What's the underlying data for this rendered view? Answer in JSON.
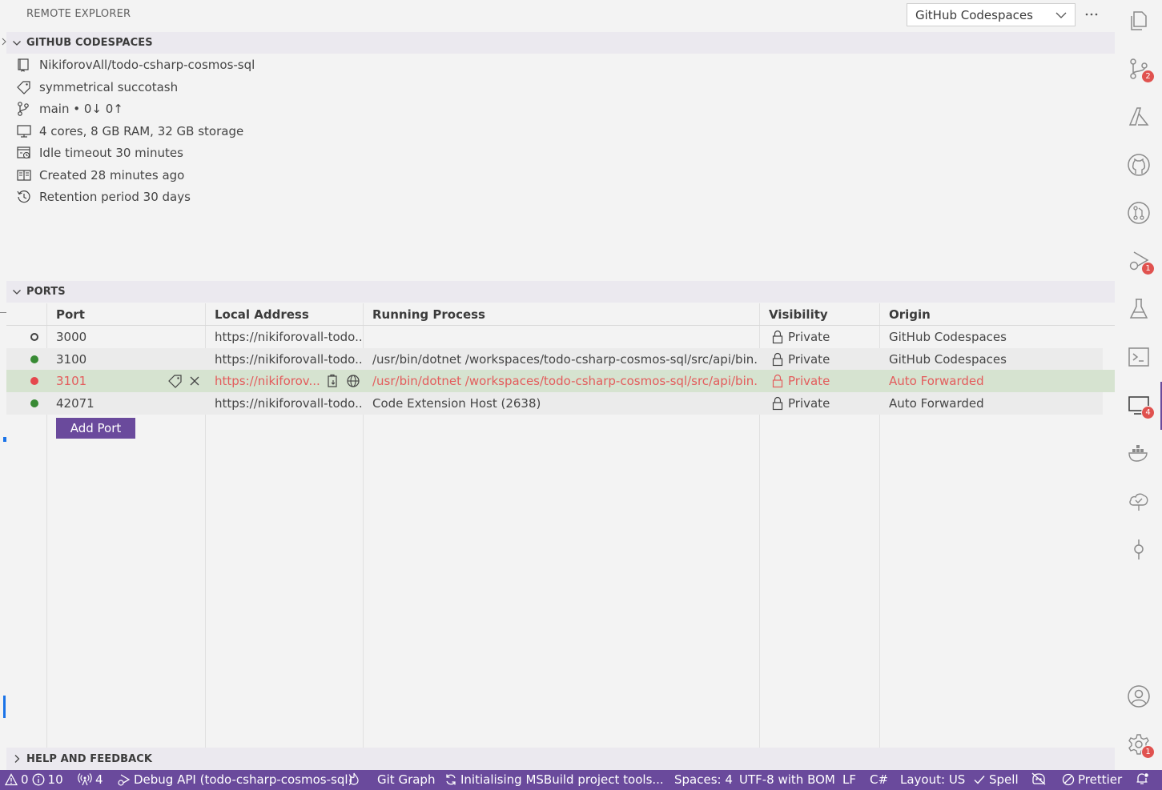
{
  "panel": {
    "title": "REMOTE EXPLORER",
    "view_select": "GitHub Codespaces"
  },
  "codespaces": {
    "header": "GITHUB CODESPACES",
    "items": [
      {
        "icon": "repo-icon",
        "label": "NikiforovAll/todo-csharp-cosmos-sql"
      },
      {
        "icon": "tag-icon",
        "label": "symmetrical succotash"
      },
      {
        "icon": "git-branch-icon",
        "label": "main • 0↓ 0↑"
      },
      {
        "icon": "vm-icon",
        "label": "4 cores, 8 GB RAM, 32 GB storage"
      },
      {
        "icon": "timeout-icon",
        "label": "Idle timeout 30 minutes"
      },
      {
        "icon": "book-icon",
        "label": "Created 28 minutes ago"
      },
      {
        "icon": "history-icon",
        "label": "Retention period 30 days"
      }
    ]
  },
  "ports": {
    "header": "PORTS",
    "columns": {
      "port": "Port",
      "local": "Local Address",
      "process": "Running Process",
      "visibility": "Visibility",
      "origin": "Origin"
    },
    "rows": [
      {
        "status": "inactive",
        "port": "3000",
        "local": "https://nikiforovall-todo...",
        "process": "",
        "visibility": "Private",
        "origin": "GitHub Codespaces"
      },
      {
        "status": "running",
        "port": "3100",
        "local": "https://nikiforovall-todo...",
        "process": "/usr/bin/dotnet /workspaces/todo-csharp-cosmos-sql/src/api/bin...",
        "visibility": "Private",
        "origin": "GitHub Codespaces"
      },
      {
        "status": "error",
        "port": "3101",
        "local": "https://nikiforov...",
        "process": "/usr/bin/dotnet /workspaces/todo-csharp-cosmos-sql/src/api/bin...",
        "visibility": "Private",
        "origin": "Auto Forwarded"
      },
      {
        "status": "running",
        "port": "42071",
        "local": "https://nikiforovall-todo...",
        "process": "Code Extension Host (2638)",
        "visibility": "Private",
        "origin": "Auto Forwarded"
      }
    ],
    "add_port": "Add Port"
  },
  "help": {
    "header": "HELP AND FEEDBACK"
  },
  "activity_bar": {
    "items": [
      {
        "name": "explorer-icon"
      },
      {
        "name": "source-control-icon",
        "badge": "2"
      },
      {
        "name": "azure-icon"
      },
      {
        "name": "github-icon"
      },
      {
        "name": "pull-requests-icon"
      },
      {
        "name": "run-debug-icon",
        "badge": "1"
      },
      {
        "name": "testing-icon"
      },
      {
        "name": "terminal-icon"
      },
      {
        "name": "remote-explorer-icon",
        "badge": "4"
      },
      {
        "name": "docker-icon"
      },
      {
        "name": "cloud-check-icon"
      },
      {
        "name": "git-commit-icon"
      }
    ],
    "accounts": {
      "name": "accounts-icon"
    },
    "manage": {
      "name": "manage-gear-icon",
      "badge": "1"
    }
  },
  "statusbar": {
    "warnings": "0",
    "infos": "10",
    "ports_count": "4",
    "debug": "Debug API (todo-csharp-cosmos-sql)",
    "git_graph": "Git Graph",
    "task": "Initialising MSBuild project tools...",
    "spaces": "Spaces: 4",
    "encoding": "UTF-8 with BOM",
    "eol": "LF",
    "language": "C#",
    "layout": "Layout: US",
    "spell": "Spell",
    "prettier": "Prettier"
  },
  "colors": {
    "accent": "#6a4a9c",
    "error": "#e35c5c",
    "running": "#388a34",
    "selected_row": "#d6e3d0",
    "badge": "#e0524f"
  }
}
